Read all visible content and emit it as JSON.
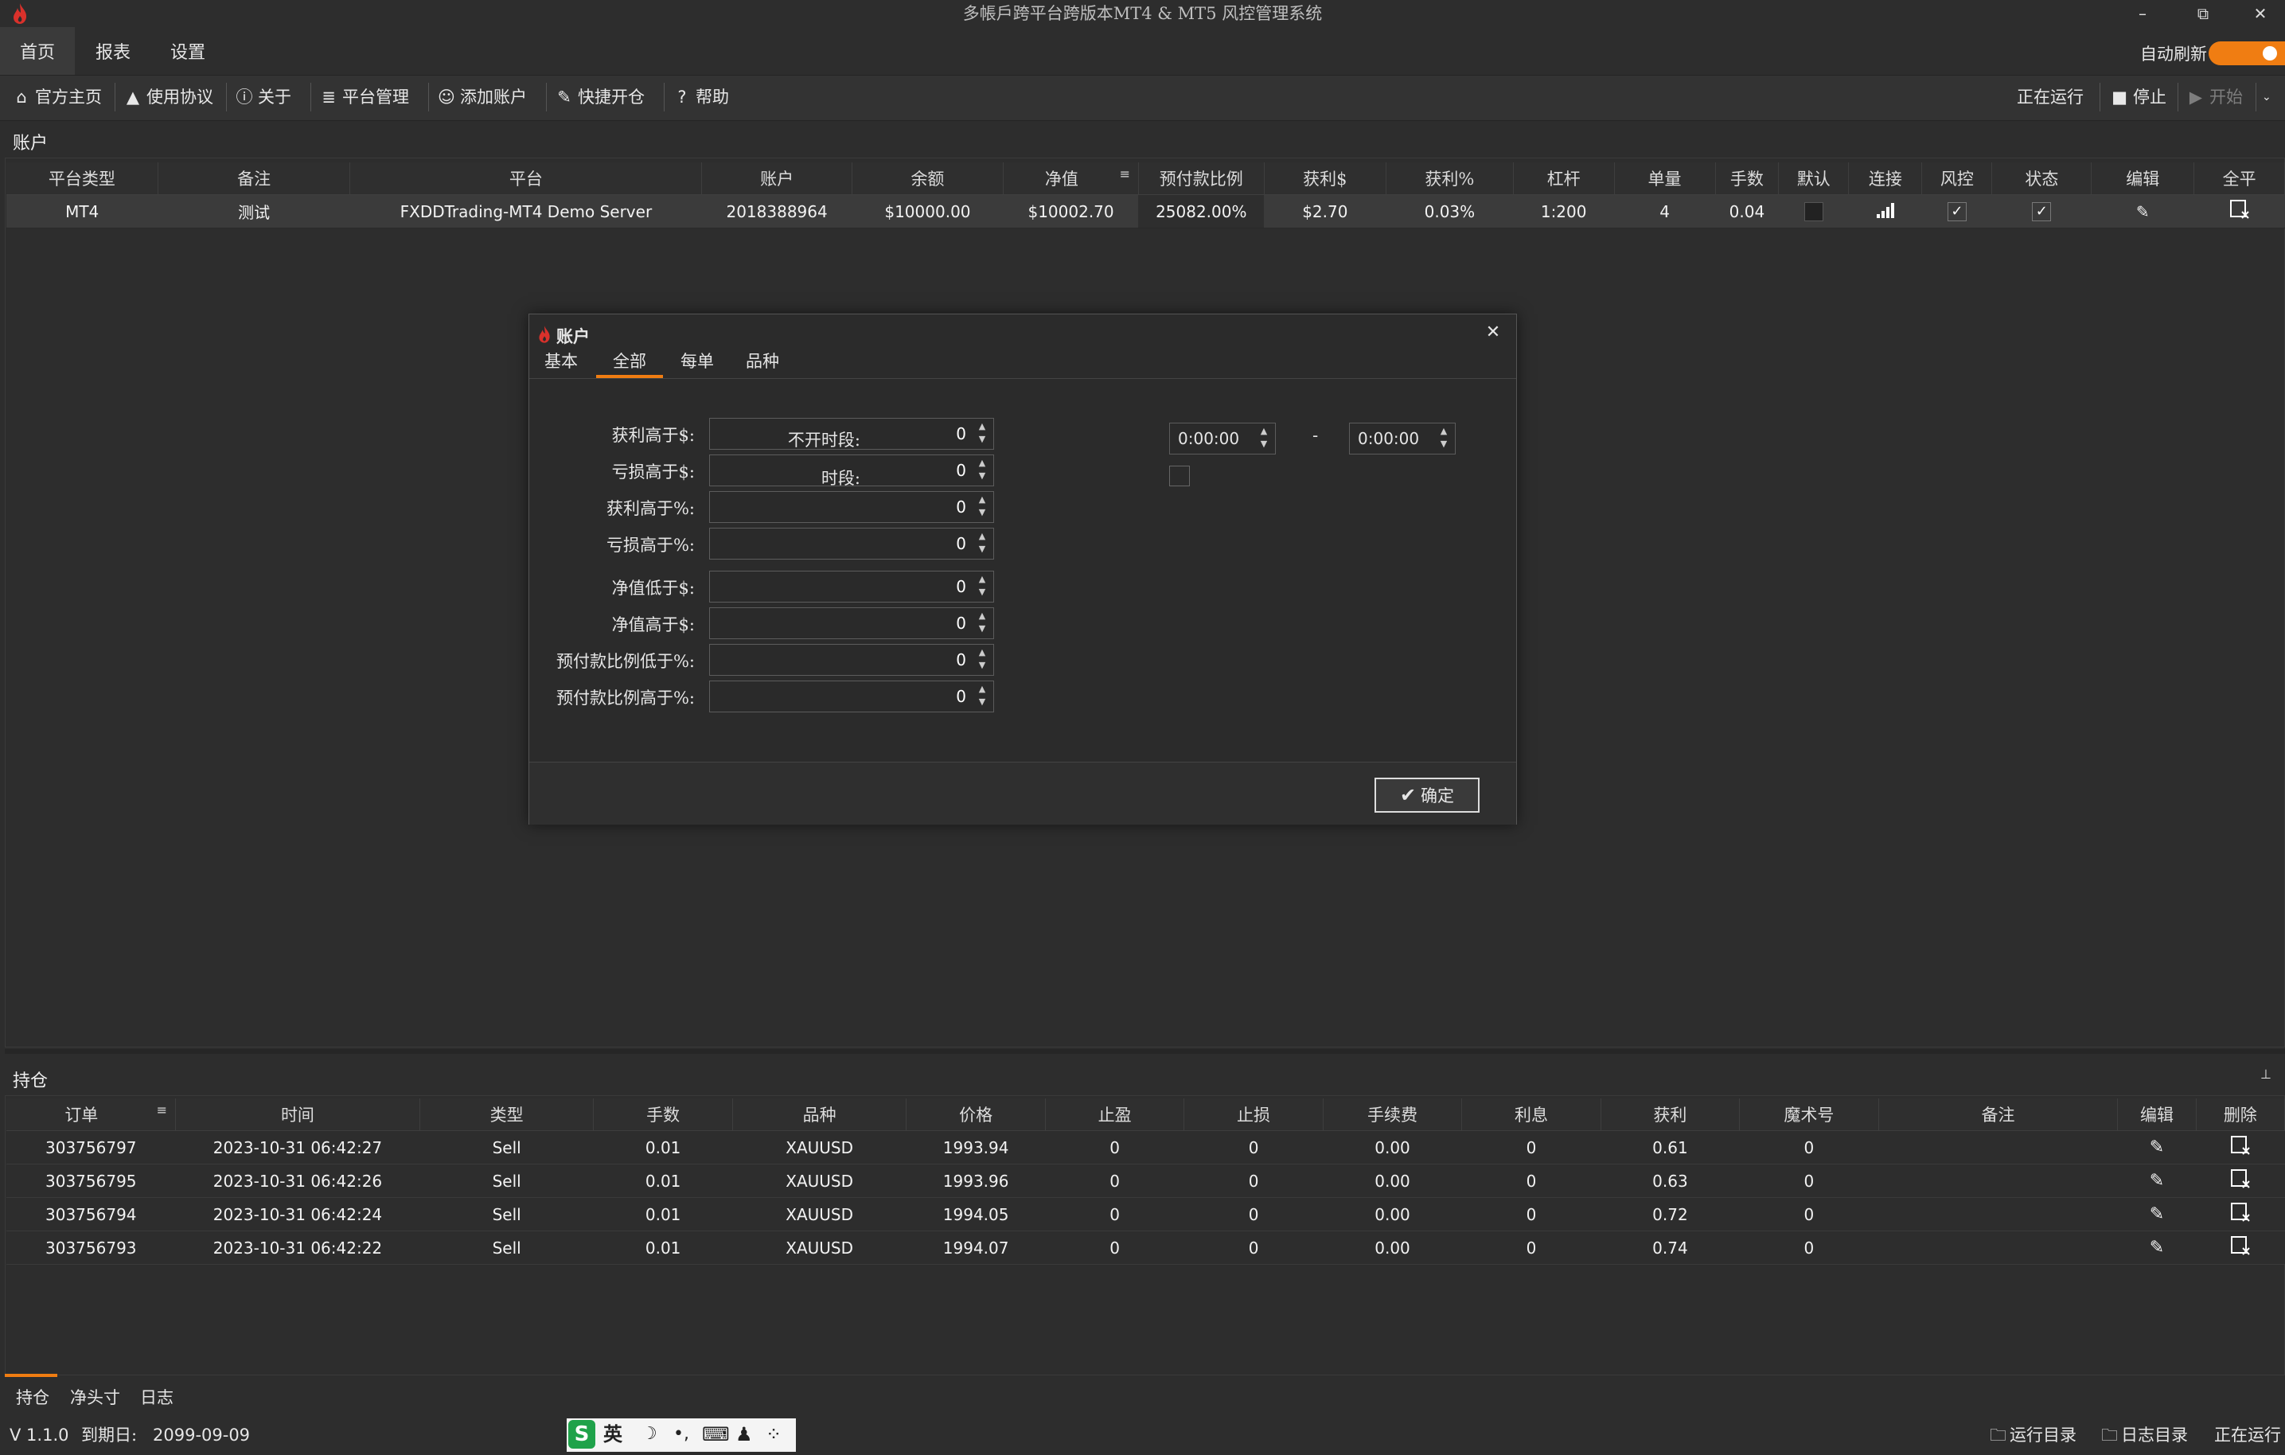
{
  "window": {
    "title": "多帳戶跨平台跨版本MT4 & MT5 风控管理系统",
    "minimize_icon": "–",
    "restore_icon": "⧉",
    "close_icon": "✕"
  },
  "menu": {
    "items": [
      "首页",
      "报表",
      "设置"
    ],
    "auto_refresh_label": "自动刷新"
  },
  "toolbar": {
    "items": [
      {
        "label": "官方主页",
        "icon": "home-icon",
        "glyph": "⌂"
      },
      {
        "label": "使用协议",
        "icon": "warning-icon",
        "glyph": "▲"
      },
      {
        "label": "关于",
        "icon": "info-icon",
        "glyph": "ⓘ"
      },
      {
        "label": "平台管理",
        "icon": "database-icon",
        "glyph": "≣"
      },
      {
        "label": "添加账户",
        "icon": "user-icon",
        "glyph": "☺"
      },
      {
        "label": "快捷开仓",
        "icon": "edit-icon",
        "glyph": "✎"
      },
      {
        "label": "帮助",
        "icon": "help-icon",
        "glyph": "?"
      }
    ],
    "running_label": "正在运行",
    "stop_label": "停止",
    "start_label": "开始",
    "stop_glyph": "■",
    "start_glyph": "▶"
  },
  "accounts": {
    "panel_title": "账户",
    "columns": [
      "平台类型",
      "备注",
      "平台",
      "账户",
      "余额",
      "净值",
      "预付款比例",
      "获利$",
      "获利%",
      "杠杆",
      "单量",
      "手数",
      "默认",
      "连接",
      "风控",
      "状态",
      "编辑",
      "全平"
    ],
    "rows": [
      {
        "platform_type": "MT4",
        "remark": "测试",
        "platform": "FXDDTrading-MT4 Demo Server",
        "account": "2018388964",
        "balance": "$10000.00",
        "equity": "$10002.70",
        "margin_ratio": "25082.00%",
        "profit_usd": "$2.70",
        "profit_pct": "0.03%",
        "leverage": "1:200",
        "orders": "4",
        "lots": "0.04",
        "check_glyph": "✓"
      }
    ]
  },
  "dialog": {
    "title": "账户",
    "close_glyph": "✕",
    "tabs": [
      "基本",
      "全部",
      "每单",
      "品种"
    ],
    "active_tab": "全部",
    "fields": [
      {
        "label": "获利高于$:",
        "value": "0"
      },
      {
        "label": "亏损高于$:",
        "value": "0"
      },
      {
        "label": "获利高于%:",
        "value": "0"
      },
      {
        "label": "亏损高于%:",
        "value": "0"
      },
      {
        "label": "净值低于$:",
        "value": "0"
      },
      {
        "label": "净值高于$:",
        "value": "0"
      },
      {
        "label": "预付款比例低于%:",
        "value": "0"
      },
      {
        "label": "预付款比例高于%:",
        "value": "0"
      }
    ],
    "no_open_period_label": "不开时段:",
    "period_start": "0:00:00",
    "period_dash": "-",
    "period_end": "0:00:00",
    "period_label": "时段:",
    "ok_label": "确定",
    "ok_glyph": "✔"
  },
  "positions": {
    "panel_title": "持仓",
    "pin_glyph": "⊥",
    "columns": [
      "订单",
      "时间",
      "类型",
      "手数",
      "品种",
      "价格",
      "止盈",
      "止损",
      "手续费",
      "利息",
      "获利",
      "魔术号",
      "备注",
      "编辑",
      "删除"
    ],
    "rows": [
      {
        "order": "303756797",
        "time": "2023-10-31 06:42:27",
        "type": "Sell",
        "lots": "0.01",
        "symbol": "XAUUSD",
        "price": "1993.94",
        "tp": "0",
        "sl": "0",
        "fee": "0.00",
        "swap": "0",
        "profit": "0.61",
        "magic": "0"
      },
      {
        "order": "303756795",
        "time": "2023-10-31 06:42:26",
        "type": "Sell",
        "lots": "0.01",
        "symbol": "XAUUSD",
        "price": "1993.96",
        "tp": "0",
        "sl": "0",
        "fee": "0.00",
        "swap": "0",
        "profit": "0.63",
        "magic": "0"
      },
      {
        "order": "303756794",
        "time": "2023-10-31 06:42:24",
        "type": "Sell",
        "lots": "0.01",
        "symbol": "XAUUSD",
        "price": "1994.05",
        "tp": "0",
        "sl": "0",
        "fee": "0.00",
        "swap": "0",
        "profit": "0.72",
        "magic": "0"
      },
      {
        "order": "303756793",
        "time": "2023-10-31 06:42:22",
        "type": "Sell",
        "lots": "0.01",
        "symbol": "XAUUSD",
        "price": "1994.07",
        "tp": "0",
        "sl": "0",
        "fee": "0.00",
        "swap": "0",
        "profit": "0.74",
        "magic": "0"
      }
    ],
    "bottom_tabs": [
      "持仓",
      "净头寸",
      "日志"
    ],
    "active_bottom_tab": "持仓"
  },
  "statusbar": {
    "version": "V 1.1.0",
    "expiry_label": "到期日:",
    "expiry_date": "2099-09-09",
    "ime_items": [
      "S",
      "英",
      "☽",
      "•,",
      "⌨",
      "♟",
      "⁘"
    ],
    "run_dir_label": "运行目录",
    "log_dir_label": "日志目录",
    "status_label": "正在运行",
    "folder_glyph": "🗀"
  },
  "colors": {
    "accent": "#f07d12",
    "background": "#2d2d2d",
    "logo": "#d9312b"
  }
}
